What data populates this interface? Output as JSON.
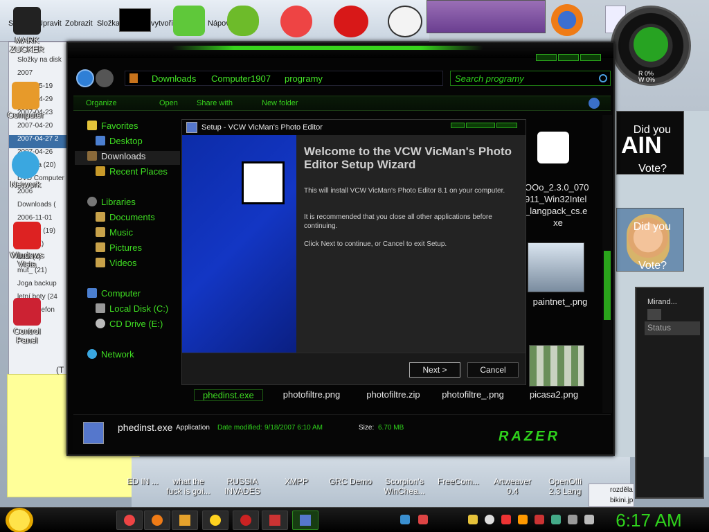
{
  "top_window": {
    "menu": [
      "Soubor",
      "Upravit",
      "Zobrazit",
      "Složka",
      "vytvořit",
      "Nápov"
    ],
    "tree": [
      "Složky na disk",
      "2007",
      "2007-05-19",
      "2007-04-29",
      "2007-04-23",
      "2007-04-20",
      "2007-04-27 2",
      "2007-04-26",
      "Aurama (20)",
      "DVD Computer",
      "2006",
      "Downloads (",
      "2006-11-01",
      "lednový (19)",
      "plyn (11)",
      "data (4)",
      "mut_ (21)",
      "Joga backup",
      "letní boty (24",
      "fotky telefon"
    ]
  },
  "desktop_icons": [
    {
      "label": "MARK ZUCKER"
    },
    {
      "label": "Computer"
    },
    {
      "label": "Network"
    },
    {
      "label": "Windows Vista"
    },
    {
      "label": "Control Panel"
    }
  ],
  "quick_launch": [
    {
      "label": "ED IN ..."
    },
    {
      "label": "what the fuck is goi..."
    },
    {
      "label": "RUSSIA INVADES"
    },
    {
      "label": "XMPP"
    },
    {
      "label": "GRC Demo"
    },
    {
      "label": "Scorpion's WinChea..."
    },
    {
      "label": "FreeCom..."
    },
    {
      "label": "Artweaver 0.4"
    },
    {
      "label": "OpenOffi 2.3 Lang"
    }
  ],
  "vote_widgets": [
    {
      "big": "AIN",
      "small": "Did you",
      "bottom": "Vote?"
    },
    {
      "small": "Did you",
      "bottom": "Vote?"
    }
  ],
  "gauge": {
    "read": "R 0%",
    "write": "W 0%"
  },
  "miranda": {
    "title": "Mirand...",
    "status": "Status"
  },
  "explorer": {
    "breadcrumb": [
      "Downloads",
      "Computer1907",
      "programy"
    ],
    "search_placeholder": "Search programy",
    "toolbar": {
      "organize": "Organize",
      "open": "Open",
      "share": "Share with",
      "new_folder": "New folder"
    },
    "nav": [
      {
        "label": "Favorites",
        "icon": "star-icon"
      },
      {
        "label": "Desktop",
        "icon": "desktop-icon"
      },
      {
        "label": "Downloads",
        "icon": "downloads-icon"
      },
      {
        "label": "Recent Places",
        "icon": "recent-places-icon"
      },
      {
        "label": "Libraries",
        "icon": "libraries-icon"
      },
      {
        "label": "Documents",
        "icon": "documents-icon"
      },
      {
        "label": "Music",
        "icon": "music-icon"
      },
      {
        "label": "Pictures",
        "icon": "pictures-icon"
      },
      {
        "label": "Videos",
        "icon": "videos-icon"
      },
      {
        "label": "Computer",
        "icon": "computer-icon"
      },
      {
        "label": "Local Disk (C:)",
        "icon": "local-disk-icon"
      },
      {
        "label": "CD Drive (E:)",
        "icon": "cd-drive-icon"
      },
      {
        "label": "Network",
        "icon": "network-icon"
      }
    ],
    "files": {
      "ooo": [
        "OOo_2.3.0_070",
        "911_Win32Intel",
        "_langpack_cs.e",
        "xe"
      ],
      "paintnet": "paintnet_.png",
      "row": [
        "phedinst.exe",
        "photofiltre.png",
        "photofiltre.zip",
        "photofiltre_.png",
        "picasa2.png"
      ]
    },
    "status": {
      "name": "phedinst.exe",
      "type": "Application",
      "date_label": "Date modified:",
      "date_value": "9/18/2007 6:10 AM",
      "size_label": "Size:",
      "size_value": "6.70 MB",
      "logo": "RAZER"
    }
  },
  "setup": {
    "title": "Setup - VCW VicMan's Photo Editor",
    "heading": "Welcome to the VCW VicMan's Photo Editor Setup Wizard",
    "p1": "This will install VCW VicMan's Photo Editor 8.1 on your computer.",
    "p2": "It is recommended that you close all other applications before continuing.",
    "p3": "Click Next to continue, or Cancel to exit Setup.",
    "next": "Next >",
    "cancel": "Cancel"
  },
  "taskbar": {
    "clock": "6:17 AM"
  },
  "misc": {
    "note_header": "(T",
    "file_fragment": "rozděla",
    "file_fragment2": "bikini.jp"
  },
  "colors": {
    "accent": "#2fd21c",
    "explorer_bg": "#050505",
    "wizard_blue": "#1336c4"
  }
}
